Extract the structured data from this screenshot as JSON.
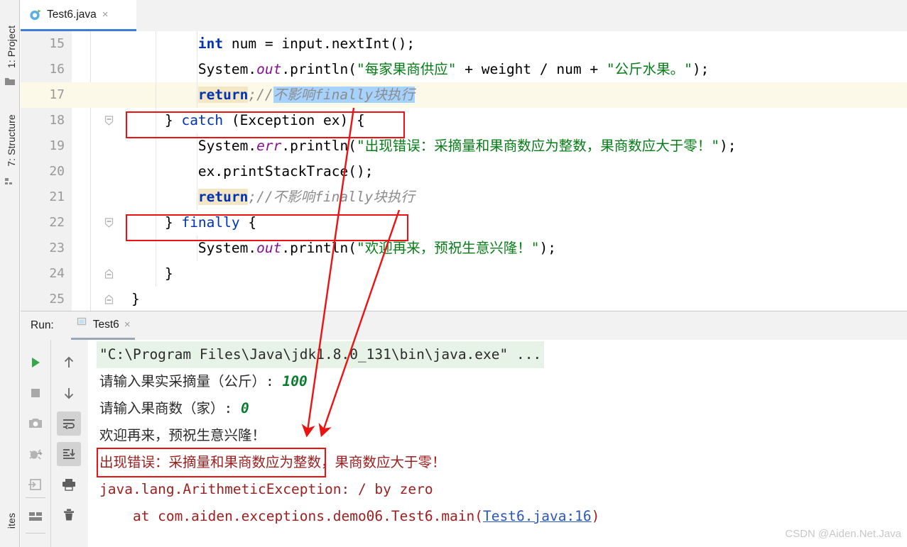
{
  "window": {
    "left_strip": [
      {
        "label": "1: Project",
        "icon": "project-folder-icon"
      },
      {
        "label": "7: Structure",
        "icon": "structure-icon"
      },
      {
        "label": "ites",
        "icon": "favorites-icon"
      }
    ]
  },
  "tabs": [
    {
      "label": "Test6.java",
      "icon": "java-class-icon",
      "close": "×",
      "active": true
    }
  ],
  "editor": {
    "lines": [
      {
        "number": "15",
        "indent_guides": 2,
        "fold": "",
        "caret": false,
        "segments": [
          {
            "text": "        ",
            "style": "plain"
          },
          {
            "text": "int",
            "style": "kw"
          },
          {
            "text": " num = input.nextInt();",
            "style": "plain"
          }
        ]
      },
      {
        "number": "16",
        "indent_guides": 2,
        "fold": "",
        "caret": false,
        "segments": [
          {
            "text": "        System.",
            "style": "plain"
          },
          {
            "text": "out",
            "style": "fld"
          },
          {
            "text": ".println(",
            "style": "plain"
          },
          {
            "text": "\"每家果商供应\"",
            "style": "str"
          },
          {
            "text": " + weight / num + ",
            "style": "plain"
          },
          {
            "text": "\"公斤水果。\"",
            "style": "str"
          },
          {
            "text": ");",
            "style": "plain"
          }
        ]
      },
      {
        "number": "17",
        "indent_guides": 2,
        "fold": "",
        "caret": true,
        "segments": [
          {
            "text": "        ",
            "style": "plain"
          },
          {
            "text": "return",
            "style": "kw-hl"
          },
          {
            "text": ";//",
            "style": "cmt"
          },
          {
            "text": "不影响finally块执行",
            "style": "cmt-sel"
          }
        ]
      },
      {
        "number": "18",
        "indent_guides": 1,
        "fold": "collapse",
        "caret": false,
        "segments": [
          {
            "text": "    } ",
            "style": "plain"
          },
          {
            "text": "catch",
            "style": "kw2"
          },
          {
            "text": " (Exception ex) {",
            "style": "plain"
          }
        ]
      },
      {
        "number": "19",
        "indent_guides": 2,
        "fold": "",
        "caret": false,
        "segments": [
          {
            "text": "        System.",
            "style": "plain"
          },
          {
            "text": "err",
            "style": "fld"
          },
          {
            "text": ".println(",
            "style": "plain"
          },
          {
            "text": "\"出现错误：采摘量和果商数应为整数，果商数应大于零！\"",
            "style": "str"
          },
          {
            "text": ");",
            "style": "plain"
          }
        ]
      },
      {
        "number": "20",
        "indent_guides": 2,
        "fold": "",
        "caret": false,
        "segments": [
          {
            "text": "        ex.printStackTrace();",
            "style": "plain"
          }
        ]
      },
      {
        "number": "21",
        "indent_guides": 2,
        "fold": "",
        "caret": false,
        "segments": [
          {
            "text": "        ",
            "style": "plain"
          },
          {
            "text": "return",
            "style": "kw-hl"
          },
          {
            "text": ";//不影响finally块执行",
            "style": "cmt"
          }
        ]
      },
      {
        "number": "22",
        "indent_guides": 1,
        "fold": "collapse",
        "caret": false,
        "segments": [
          {
            "text": "    } ",
            "style": "plain"
          },
          {
            "text": "finally",
            "style": "kw2"
          },
          {
            "text": " {",
            "style": "plain"
          }
        ]
      },
      {
        "number": "23",
        "indent_guides": 2,
        "fold": "",
        "caret": false,
        "segments": [
          {
            "text": "        System.",
            "style": "plain"
          },
          {
            "text": "out",
            "style": "fld"
          },
          {
            "text": ".println(",
            "style": "plain"
          },
          {
            "text": "\"欢迎再来，预祝生意兴隆！\"",
            "style": "str"
          },
          {
            "text": ");",
            "style": "plain"
          }
        ]
      },
      {
        "number": "24",
        "indent_guides": 1,
        "fold": "end",
        "caret": false,
        "segments": [
          {
            "text": "    }",
            "style": "plain"
          }
        ]
      },
      {
        "number": "25",
        "indent_guides": 0,
        "fold": "end",
        "caret": false,
        "segments": [
          {
            "text": "}",
            "style": "plain"
          }
        ]
      }
    ]
  },
  "run_panel": {
    "label": "Run:",
    "tab": {
      "label": "Test6",
      "icon": "run-config-icon",
      "close": "×"
    },
    "toolbar_left": [
      {
        "name": "rerun-button",
        "icon": "play-icon"
      },
      {
        "name": "stop-button",
        "icon": "stop-icon"
      },
      {
        "name": "screenshot-button",
        "icon": "camera-icon"
      },
      {
        "name": "debug-button",
        "icon": "bug-icon"
      },
      {
        "name": "export-button",
        "icon": "export-icon"
      },
      {
        "name": "layout-button",
        "icon": "layout-icon"
      }
    ],
    "toolbar_right": [
      {
        "name": "up-button",
        "icon": "arrow-up-icon"
      },
      {
        "name": "down-button",
        "icon": "arrow-down-icon"
      },
      {
        "name": "soft-wrap-button",
        "icon": "soft-wrap-icon",
        "active": true
      },
      {
        "name": "scroll-to-end-button",
        "icon": "scroll-end-icon",
        "active": true
      },
      {
        "name": "print-button",
        "icon": "printer-icon"
      },
      {
        "name": "clear-all-button",
        "icon": "trash-icon"
      }
    ],
    "console": [
      {
        "style": "cmd",
        "segments": [
          {
            "text": "\"C:\\Program Files\\Java\\jdk1.8.0_131\\bin\\java.exe\" ...",
            "style": "plain"
          }
        ]
      },
      {
        "style": "normal",
        "segments": [
          {
            "text": "请输入果实采摘量（公斤）: ",
            "style": "prompt"
          },
          {
            "text": "100",
            "style": "input"
          }
        ]
      },
      {
        "style": "normal",
        "segments": [
          {
            "text": "请输入果商数（家）: ",
            "style": "prompt"
          },
          {
            "text": "0",
            "style": "input"
          }
        ]
      },
      {
        "style": "normal",
        "segments": [
          {
            "text": "欢迎再来，预祝生意兴隆！",
            "style": "prompt"
          }
        ]
      },
      {
        "style": "normal",
        "segments": [
          {
            "text": "出现错误：采摘量和果商数应为整数，果商数应大于零！",
            "style": "err"
          }
        ]
      },
      {
        "style": "normal",
        "segments": [
          {
            "text": "java.lang.ArithmeticException: / by zero",
            "style": "err"
          }
        ]
      },
      {
        "style": "normal",
        "segments": [
          {
            "text": "    at com.aiden.exceptions.demo06.Test6.main(",
            "style": "err"
          },
          {
            "text": "Test6.java:16",
            "style": "link"
          },
          {
            "text": ")",
            "style": "err"
          }
        ]
      }
    ]
  },
  "watermark": "CSDN @Aiden.Net.Java",
  "colors": {
    "accent": "#3b7dd8",
    "annotation_red": "#ee1111",
    "keyword": "#0033b3",
    "string": "#067d17",
    "field": "#871094",
    "comment": "#8c8c8c",
    "error": "#9c2020",
    "link": "#2b57b8",
    "selection": "#a6d2ff",
    "return_highlight": "#f2e6c4",
    "caret_row": "#fdf9e8"
  }
}
